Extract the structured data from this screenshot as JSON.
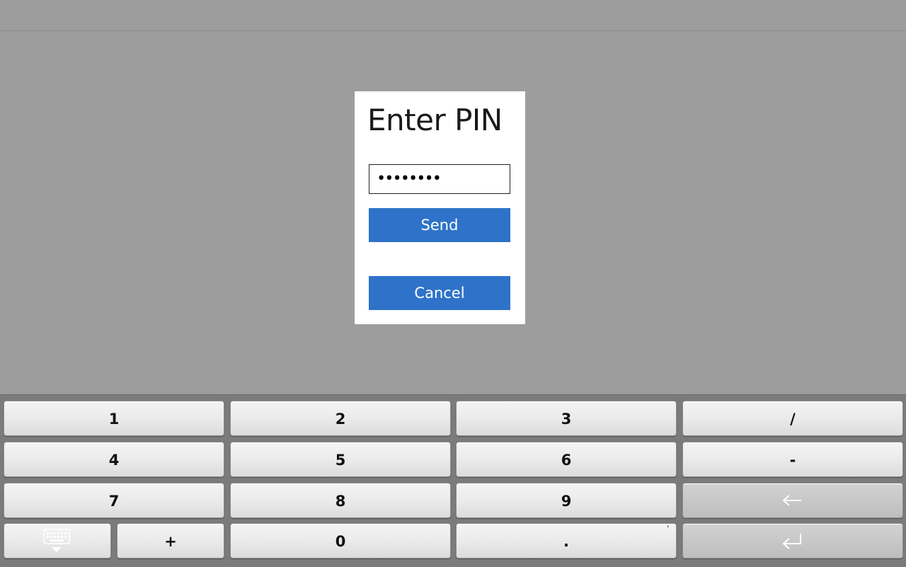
{
  "dialog": {
    "title": "Enter PIN",
    "pin_value": "••••••••",
    "send_label": "Send",
    "cancel_label": "Cancel"
  },
  "keyboard": {
    "rows": [
      [
        "1",
        "2",
        "3",
        "/"
      ],
      [
        "4",
        "5",
        "6",
        "-"
      ],
      [
        "7",
        "8",
        "9",
        "backspace"
      ],
      [
        "hide-keyboard",
        "+",
        "0",
        ".",
        "enter"
      ]
    ],
    "keys": {
      "k1": "1",
      "k2": "2",
      "k3": "3",
      "slash": "/",
      "k4": "4",
      "k5": "5",
      "k6": "6",
      "minus": "-",
      "k7": "7",
      "k8": "8",
      "k9": "9",
      "plus": "+",
      "k0": "0",
      "dot": ".",
      "dot_secondary": "'"
    }
  },
  "colors": {
    "background": "#9d9d9d",
    "dialog_button": "#2e73c9",
    "keyboard_bg": "#7b7b7b"
  }
}
